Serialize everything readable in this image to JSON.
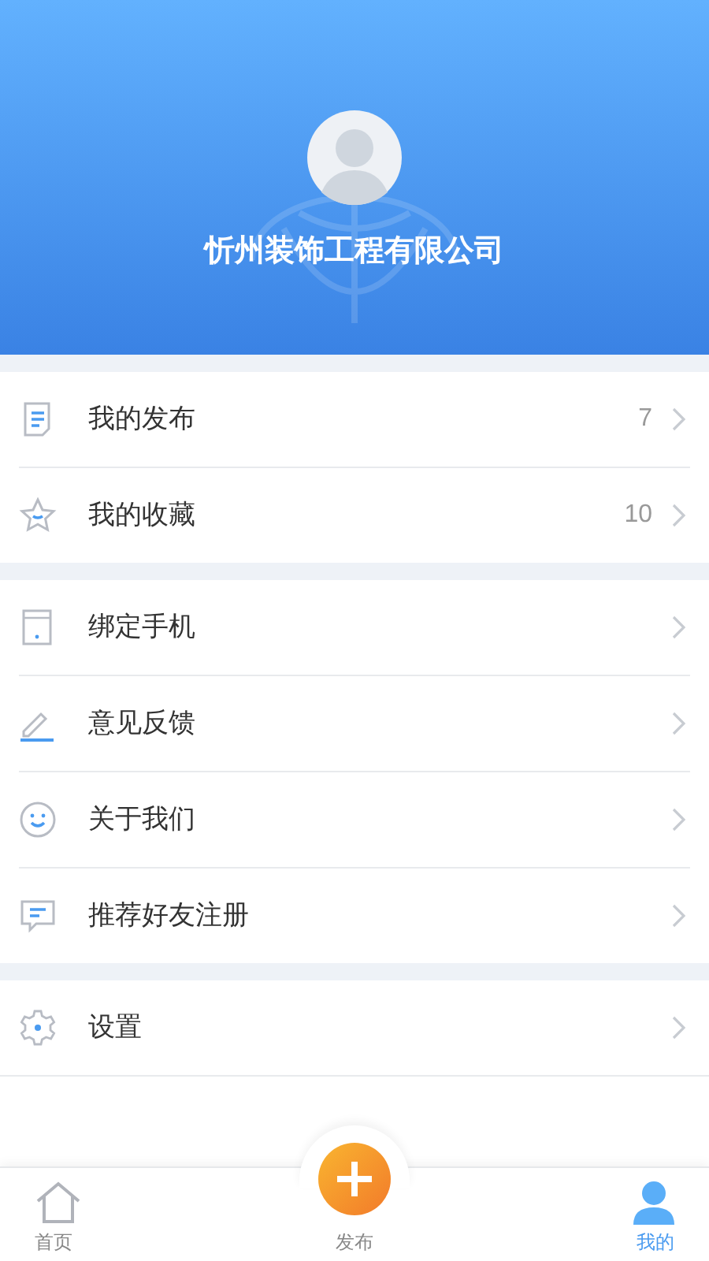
{
  "profile": {
    "company_name": "忻州装饰工程有限公司"
  },
  "sections": [
    {
      "items": [
        {
          "kind": "document",
          "label": "我的发布",
          "count": "7"
        },
        {
          "kind": "star",
          "label": "我的收藏",
          "count": "10"
        }
      ]
    },
    {
      "items": [
        {
          "kind": "tablet",
          "label": "绑定手机"
        },
        {
          "kind": "pen",
          "label": "意见反馈"
        },
        {
          "kind": "smile",
          "label": "关于我们"
        },
        {
          "kind": "chat",
          "label": "推荐好友注册"
        }
      ]
    },
    {
      "items": [
        {
          "kind": "gear",
          "label": "设置"
        }
      ]
    }
  ],
  "tab_bar": [
    {
      "kind": "home",
      "label": "首页",
      "selected": false
    },
    {
      "kind": "publish",
      "label": "发布",
      "selected": false
    },
    {
      "kind": "profile",
      "label": "我的",
      "selected": true
    }
  ]
}
